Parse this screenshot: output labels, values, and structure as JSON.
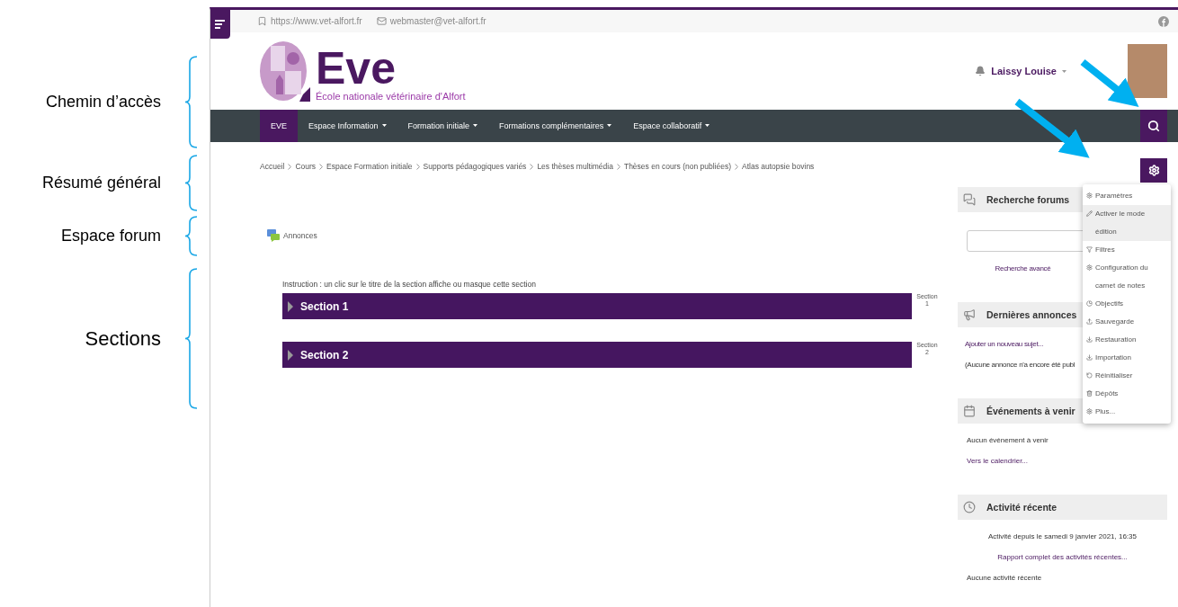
{
  "annotations": [
    {
      "label": "Chemin d’accès"
    },
    {
      "label": "Résumé général"
    },
    {
      "label": "Espace forum"
    },
    {
      "label": "Sections"
    }
  ],
  "top_bar": {
    "website": "https://www.vet-alfort.fr",
    "email": "webmaster@vet-alfort.fr"
  },
  "logo": {
    "text": "Eve",
    "subtitle": "École nationale vétérinaire d'Alfort"
  },
  "user": {
    "name": "Laissy Louise"
  },
  "nav": [
    {
      "label": "EVE",
      "selected": true,
      "dropdown": false
    },
    {
      "label": "Espace Information",
      "selected": false,
      "dropdown": true
    },
    {
      "label": "Formation initiale",
      "selected": false,
      "dropdown": true
    },
    {
      "label": "Formations complémentaires",
      "selected": false,
      "dropdown": true
    },
    {
      "label": "Espace collaboratif",
      "selected": false,
      "dropdown": true
    }
  ],
  "breadcrumb": [
    "Accueil",
    "Cours",
    "Espace Formation initiale",
    "Supports pédagogiques variés",
    "Les thèses multimédia",
    "Thèses en cours (non publiées)",
    "Atlas autopsie bovins"
  ],
  "forum": {
    "label": "Annonces"
  },
  "instruction": "Instruction : un clic sur le titre de la section affiche ou masque cette section",
  "sections": [
    {
      "title": "Section 1",
      "side_label": "Section 1"
    },
    {
      "title": "Section 2",
      "side_label": "Section 2"
    }
  ],
  "blocks": [
    {
      "title": "Recherche forums",
      "items": [
        {
          "kind": "input"
        },
        {
          "kind": "centered_link",
          "text": "Recherche avancé"
        }
      ]
    },
    {
      "title": "Dernières annonces",
      "items": [
        {
          "kind": "link",
          "text": "Ajouter un nouveau sujet..."
        },
        {
          "kind": "text",
          "text": "(Aucune annonce n'a encore été publ"
        }
      ]
    },
    {
      "title": "Événements à venir",
      "items": [
        {
          "kind": "text",
          "text": "Aucun événement à venir"
        },
        {
          "kind": "link",
          "text": "Vers le calendrier..."
        }
      ]
    },
    {
      "title": "Activité récente",
      "items": [
        {
          "kind": "centered_text",
          "text": "Activité depuis le samedi 9 janvier 2021, 16:35"
        },
        {
          "kind": "centered_link",
          "text": "Rapport complet des activités récentes..."
        },
        {
          "kind": "text",
          "text": "Aucune activité récente"
        }
      ]
    }
  ],
  "settings_menu": [
    {
      "label": "Paramètres",
      "selected": false
    },
    {
      "label": "Activer le mode édition",
      "selected": true
    },
    {
      "label": "Filtres",
      "selected": false
    },
    {
      "label": "Configuration du carnet de notes",
      "selected": false
    },
    {
      "label": "Objectifs",
      "selected": false
    },
    {
      "label": "Sauvegarde",
      "selected": false
    },
    {
      "label": "Restauration",
      "selected": false
    },
    {
      "label": "Importation",
      "selected": false
    },
    {
      "label": "Réinitialiser",
      "selected": false
    },
    {
      "label": "Dépôts",
      "selected": false
    },
    {
      "label": "Plus...",
      "selected": false
    }
  ]
}
